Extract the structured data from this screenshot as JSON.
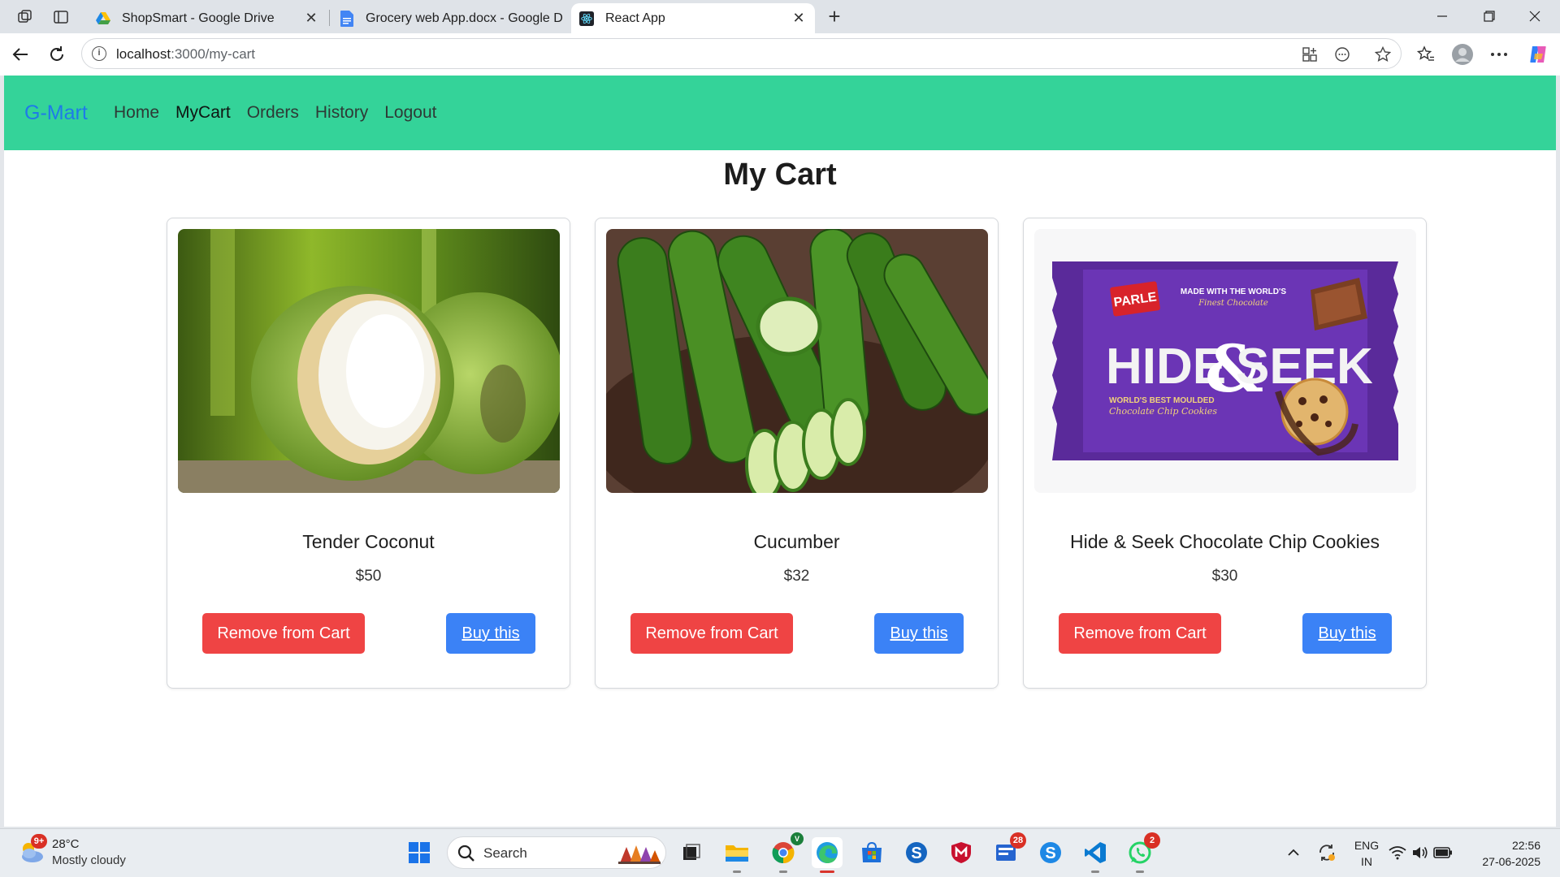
{
  "browser": {
    "tabs": [
      {
        "title": "ShopSmart - Google Drive",
        "icon": "google-drive-icon"
      },
      {
        "title": "Grocery web App.docx - Google D",
        "icon": "google-docs-icon"
      },
      {
        "title": "React App",
        "icon": "react-icon",
        "active": true
      }
    ],
    "close_glyph": "✕",
    "new_tab_glyph": "+",
    "url_host": "localhost",
    "url_path": ":3000/my-cart"
  },
  "app": {
    "brand": "G-Mart",
    "nav": [
      "Home",
      "MyCart",
      "Orders",
      "History",
      "Logout"
    ],
    "active_nav": "MyCart",
    "page_title": "My Cart",
    "accent": "#34d399",
    "remove_label": "Remove from Cart",
    "buy_label": "Buy this",
    "items": [
      {
        "name": "Tender Coconut",
        "price": "$50",
        "image": "coconut-image"
      },
      {
        "name": "Cucumber",
        "price": "$32",
        "image": "cucumber-image"
      },
      {
        "name": "Hide & Seek Chocolate Chip Cookies",
        "price": "$30",
        "image": "cookies-pack-image"
      }
    ]
  },
  "product_art": {
    "brand": "PARLE",
    "tagline": "MADE WITH THE WORLD'S",
    "sub": "Finest Chocolate",
    "title_a": "HIDE",
    "title_amp": "&",
    "title_b": "SEEK",
    "side": "WORLD'S BEST MOULDED",
    "side2": "Chocolate Chip Cookies"
  },
  "taskbar": {
    "weather_badge": "9+",
    "temperature": "28°C",
    "condition": "Mostly cloudy",
    "search_label": "Search",
    "badges": {
      "todo": "28",
      "whatsapp": "2"
    },
    "chrome_badge": "V",
    "language": "ENG",
    "region": "IN",
    "time": "22:56",
    "date": "27-06-2025"
  }
}
